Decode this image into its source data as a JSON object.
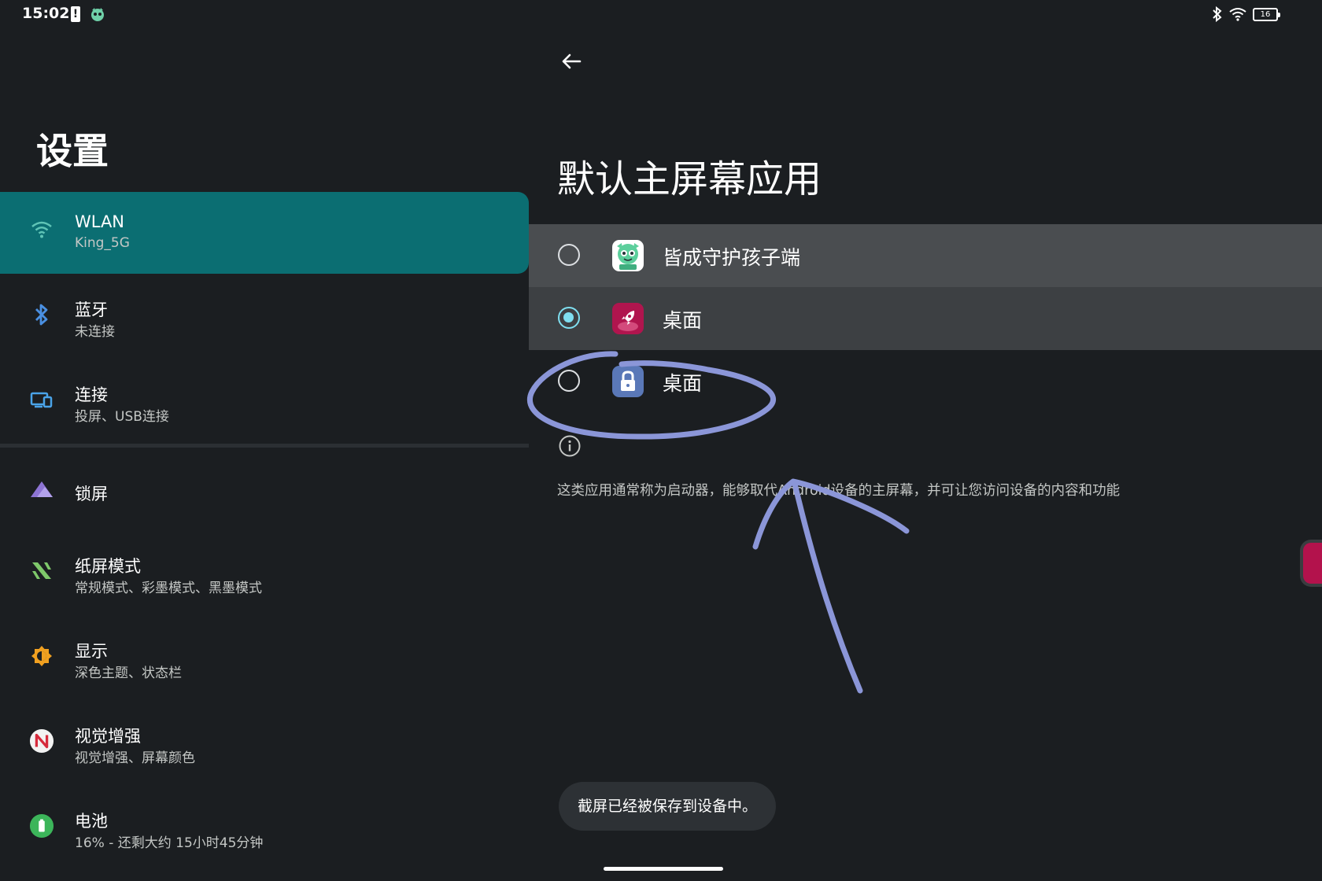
{
  "status_bar": {
    "time": "15:02",
    "battery": "16"
  },
  "settings": {
    "title": "设置",
    "items": [
      {
        "title": "WLAN",
        "subtitle": "King_5G",
        "icon": "wifi-icon"
      },
      {
        "title": "蓝牙",
        "subtitle": "未连接",
        "icon": "bluetooth-icon"
      },
      {
        "title": "连接",
        "subtitle": "投屏、USB连接",
        "icon": "devices-icon"
      },
      {
        "title": "锁屏",
        "subtitle": "",
        "icon": "lockscreen-icon"
      },
      {
        "title": "纸屏模式",
        "subtitle": "常规模式、彩墨模式、黑墨模式",
        "icon": "paper-mode-icon"
      },
      {
        "title": "显示",
        "subtitle": "深色主题、状态栏",
        "icon": "brightness-icon"
      },
      {
        "title": "视觉增强",
        "subtitle": "视觉增强、屏幕颜色",
        "icon": "visual-enhance-icon"
      },
      {
        "title": "电池",
        "subtitle": "16% - 还剩大约 15小时45分钟",
        "icon": "battery-icon"
      }
    ]
  },
  "default_home": {
    "title": "默认主屏幕应用",
    "options": [
      {
        "label": "皆成守护孩子端",
        "selected": false,
        "icon": "kid-guard-app-icon"
      },
      {
        "label": "桌面",
        "selected": true,
        "icon": "launcher-rocket-icon"
      },
      {
        "label": "桌面",
        "selected": false,
        "icon": "lock-launcher-icon"
      }
    ],
    "info": "这类应用通常称为启动器，能够取代Android设备的主屏幕，并可让您访问设备的内容和功能"
  },
  "toast": "截屏已经被保存到设备中。",
  "colors": {
    "background": "#1b1e21",
    "selected_nav": "#0b6e72",
    "radio_checked": "#7fdff0",
    "annotation": "#8b96d8"
  }
}
